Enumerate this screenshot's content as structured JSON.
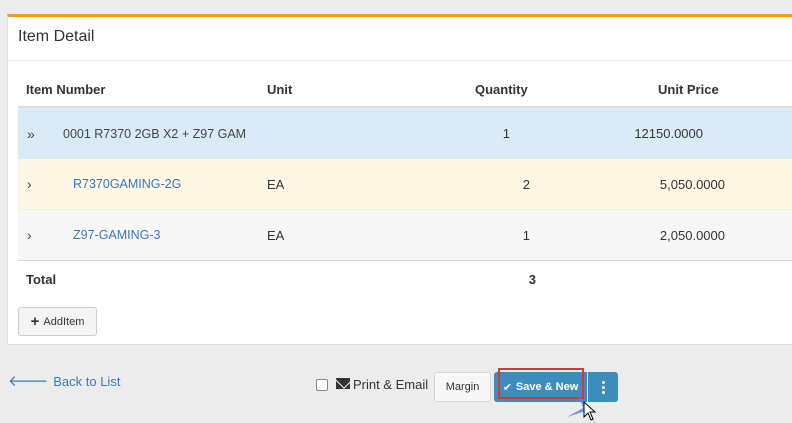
{
  "panel": {
    "title": "Item Detail"
  },
  "table": {
    "headers": {
      "item_number": "Item Number",
      "unit": "Unit",
      "quantity": "Quantity",
      "unit_price": "Unit Price"
    },
    "rows": [
      {
        "chevron": "»",
        "item": "0001 R7370 2GB X2  + Z97 GAM",
        "unit": "",
        "quantity": "1",
        "unit_price": "12150.0000"
      },
      {
        "chevron": "›",
        "item": "R7370GAMING-2G",
        "unit": "EA",
        "quantity": "2",
        "unit_price": "5,050.0000"
      },
      {
        "chevron": "›",
        "item": "Z97-GAMING-3",
        "unit": "EA",
        "quantity": "1",
        "unit_price": "2,050.0000"
      }
    ],
    "total": {
      "label": "Total",
      "quantity": "3"
    }
  },
  "actions": {
    "add_item": "AddItem",
    "back_to_list": "Back to List",
    "print_email": "Print & Email",
    "margin": "Margin",
    "save_new": "Save & New"
  },
  "colors": {
    "accent": "#f39c12",
    "primary_button": "#3c8dbc",
    "link": "#3c78b4",
    "highlight": "#d9333f"
  }
}
